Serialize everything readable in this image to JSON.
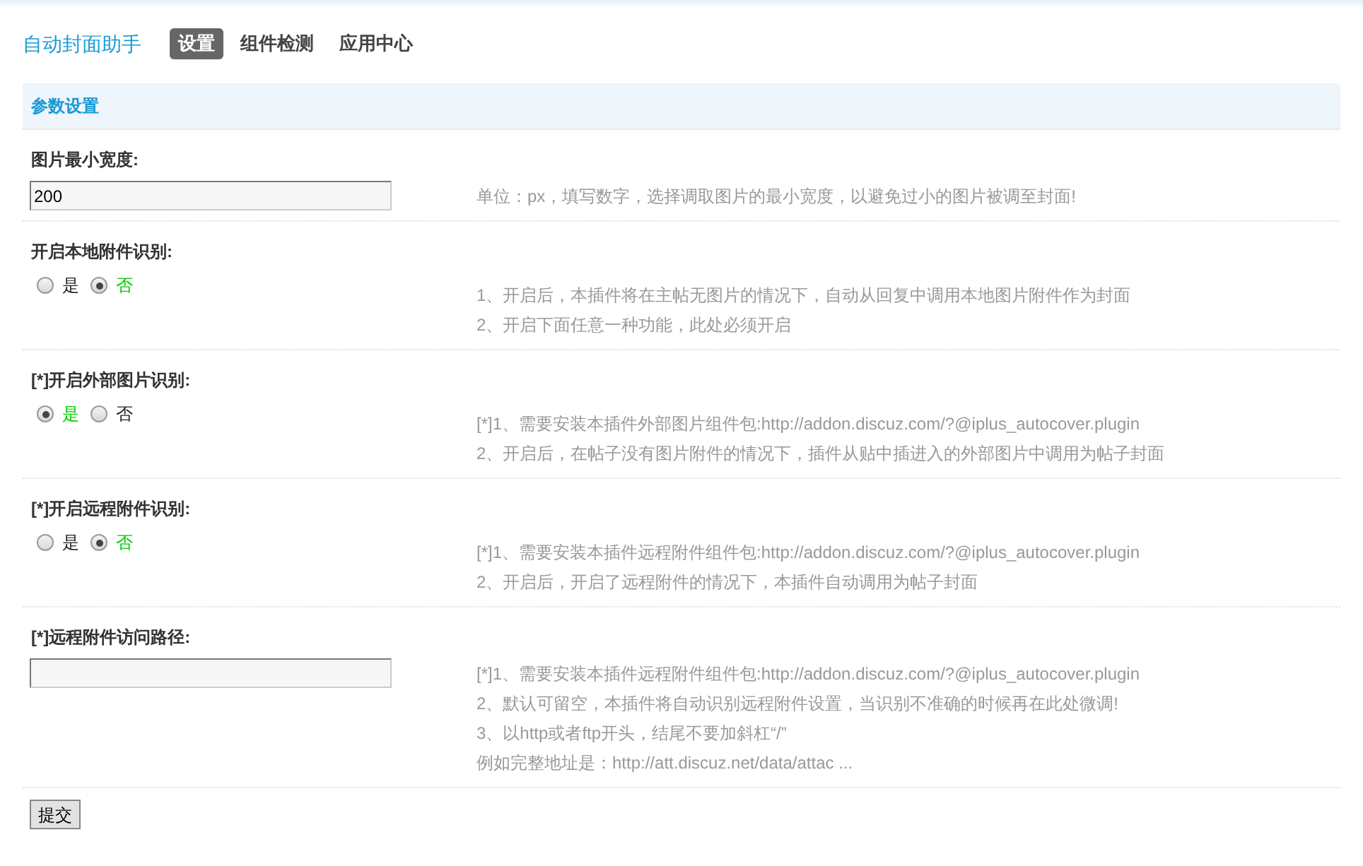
{
  "header": {
    "title": "自动封面助手",
    "tabs": [
      {
        "label": "设置",
        "selected": true
      },
      {
        "label": "组件检测",
        "selected": false
      },
      {
        "label": "应用中心",
        "selected": false
      }
    ]
  },
  "section": {
    "title": "参数设置"
  },
  "settings": [
    {
      "kind": "text",
      "label": "图片最小宽度:",
      "value": "200",
      "description": [
        "单位：px，填写数字，选择调取图片的最小宽度，以避免过小的图片被调至封面!"
      ]
    },
    {
      "kind": "radio",
      "label": "开启本地附件识别:",
      "options": [
        {
          "label": "是",
          "selected": false
        },
        {
          "label": "否",
          "selected": true
        }
      ],
      "description": [
        "1、开启后，本插件将在主帖无图片的情况下，自动从回复中调用本地图片附件作为封面",
        "2、开启下面任意一种功能，此处必须开启"
      ]
    },
    {
      "kind": "radio",
      "label": "[*]开启外部图片识别:",
      "options": [
        {
          "label": "是",
          "selected": true
        },
        {
          "label": "否",
          "selected": false
        }
      ],
      "description": [
        "[*]1、需要安装本插件外部图片组件包:http://addon.discuz.com/?@iplus_autocover.plugin",
        "2、开启后，在帖子没有图片附件的情况下，插件从贴中插进入的外部图片中调用为帖子封面"
      ]
    },
    {
      "kind": "radio",
      "label": "[*]开启远程附件识别:",
      "options": [
        {
          "label": "是",
          "selected": false
        },
        {
          "label": "否",
          "selected": true
        }
      ],
      "description": [
        "[*]1、需要安装本插件远程附件组件包:http://addon.discuz.com/?@iplus_autocover.plugin",
        "2、开启后，开启了远程附件的情况下，本插件自动调用为帖子封面"
      ]
    },
    {
      "kind": "text",
      "label": "[*]远程附件访问路径:",
      "description": [
        "[*]1、需要安装本插件远程附件组件包:http://addon.discuz.com/?@iplus_autocover.plugin",
        "2、默认可留空，本插件将自动识别远程附件设置，当识别不准确的时候再在此处微调!",
        "3、以http或者ftp开头，结尾不要加斜杠“/”",
        "例如完整地址是：http://att.discuz.net/data/attac ..."
      ]
    }
  ],
  "submit": "提交"
}
